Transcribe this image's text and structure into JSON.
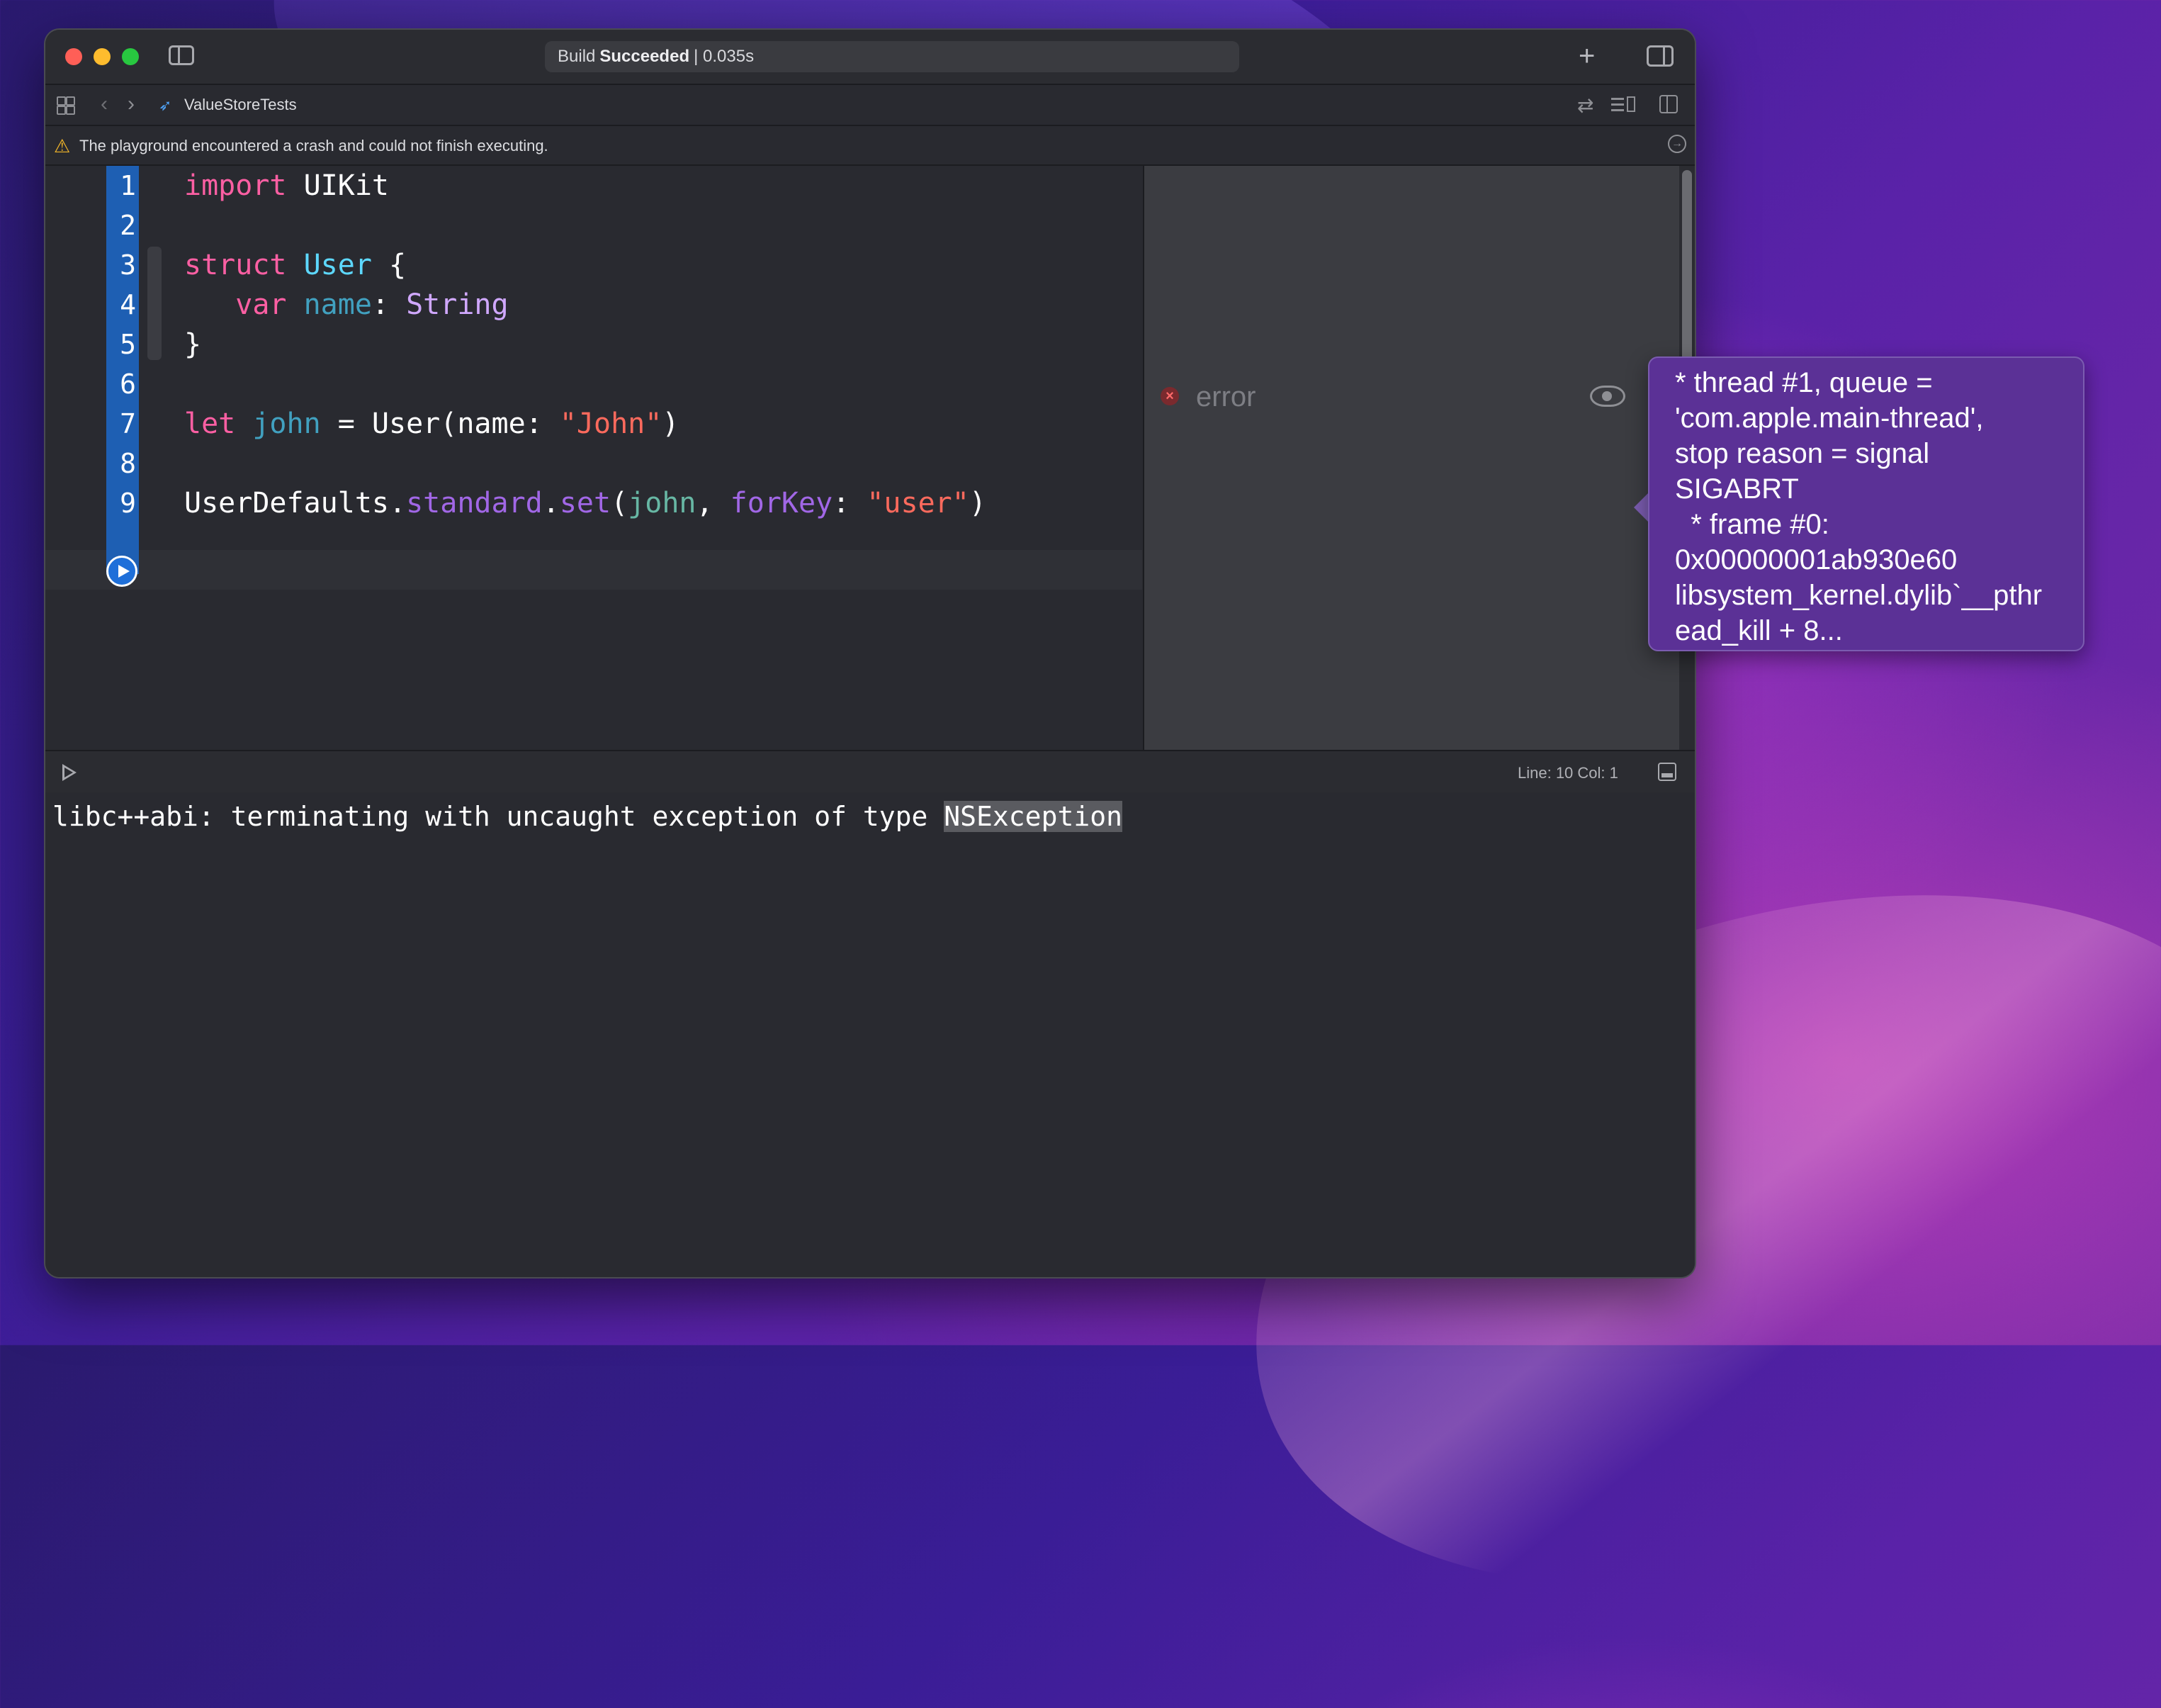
{
  "toolbar": {
    "status_prefix": "Build",
    "status_bold": "Succeeded",
    "status_suffix": "| 0.035s",
    "add_label": "+"
  },
  "jumpbar": {
    "file_name": "ValueStoreTests"
  },
  "issue": {
    "message": "The playground encountered a crash and could not finish executing."
  },
  "editor": {
    "line_numbers": [
      "1",
      "2",
      "3",
      "4",
      "5",
      "6",
      "7",
      "8",
      "9"
    ],
    "lines": {
      "l1": {
        "kw": "import",
        "t1": " UIKit"
      },
      "l3": {
        "kw": "struct",
        "sp": " ",
        "ty": "User",
        "t1": " {"
      },
      "l4": {
        "pad": "   ",
        "kw": "var",
        "sp": " ",
        "prop": "name",
        "t1": ": ",
        "ty": "String"
      },
      "l5": {
        "t1": "}"
      },
      "l7": {
        "kw": "let",
        "sp": " ",
        "prop": "john",
        "t1": " = User(name: ",
        "str": "\"John\"",
        "t2": ")"
      },
      "l9": {
        "t1": "UserDefaults.",
        "mem1": "standard",
        "t2": ".",
        "mem2": "set",
        "t3": "(",
        "fn": "john",
        "t4": ", ",
        "mem3": "forKey",
        "t5": ": ",
        "str": "\"user\"",
        "t6": ")"
      }
    }
  },
  "results": {
    "error_label": "error"
  },
  "debug": {
    "position": "Line: 10  Col: 1"
  },
  "console": {
    "text_before": "libc++abi: terminating with uncaught exception of type ",
    "text_highlight": "NSException"
  },
  "popover": {
    "lines": [
      "* thread #1, queue =",
      "'com.apple.main-thread',",
      "stop reason = signal",
      "SIGABRT",
      "  * frame #0:",
      "0x00000001ab930e60",
      "libsystem_kernel.dylib`__pthr",
      "ead_kill + 8..."
    ]
  }
}
